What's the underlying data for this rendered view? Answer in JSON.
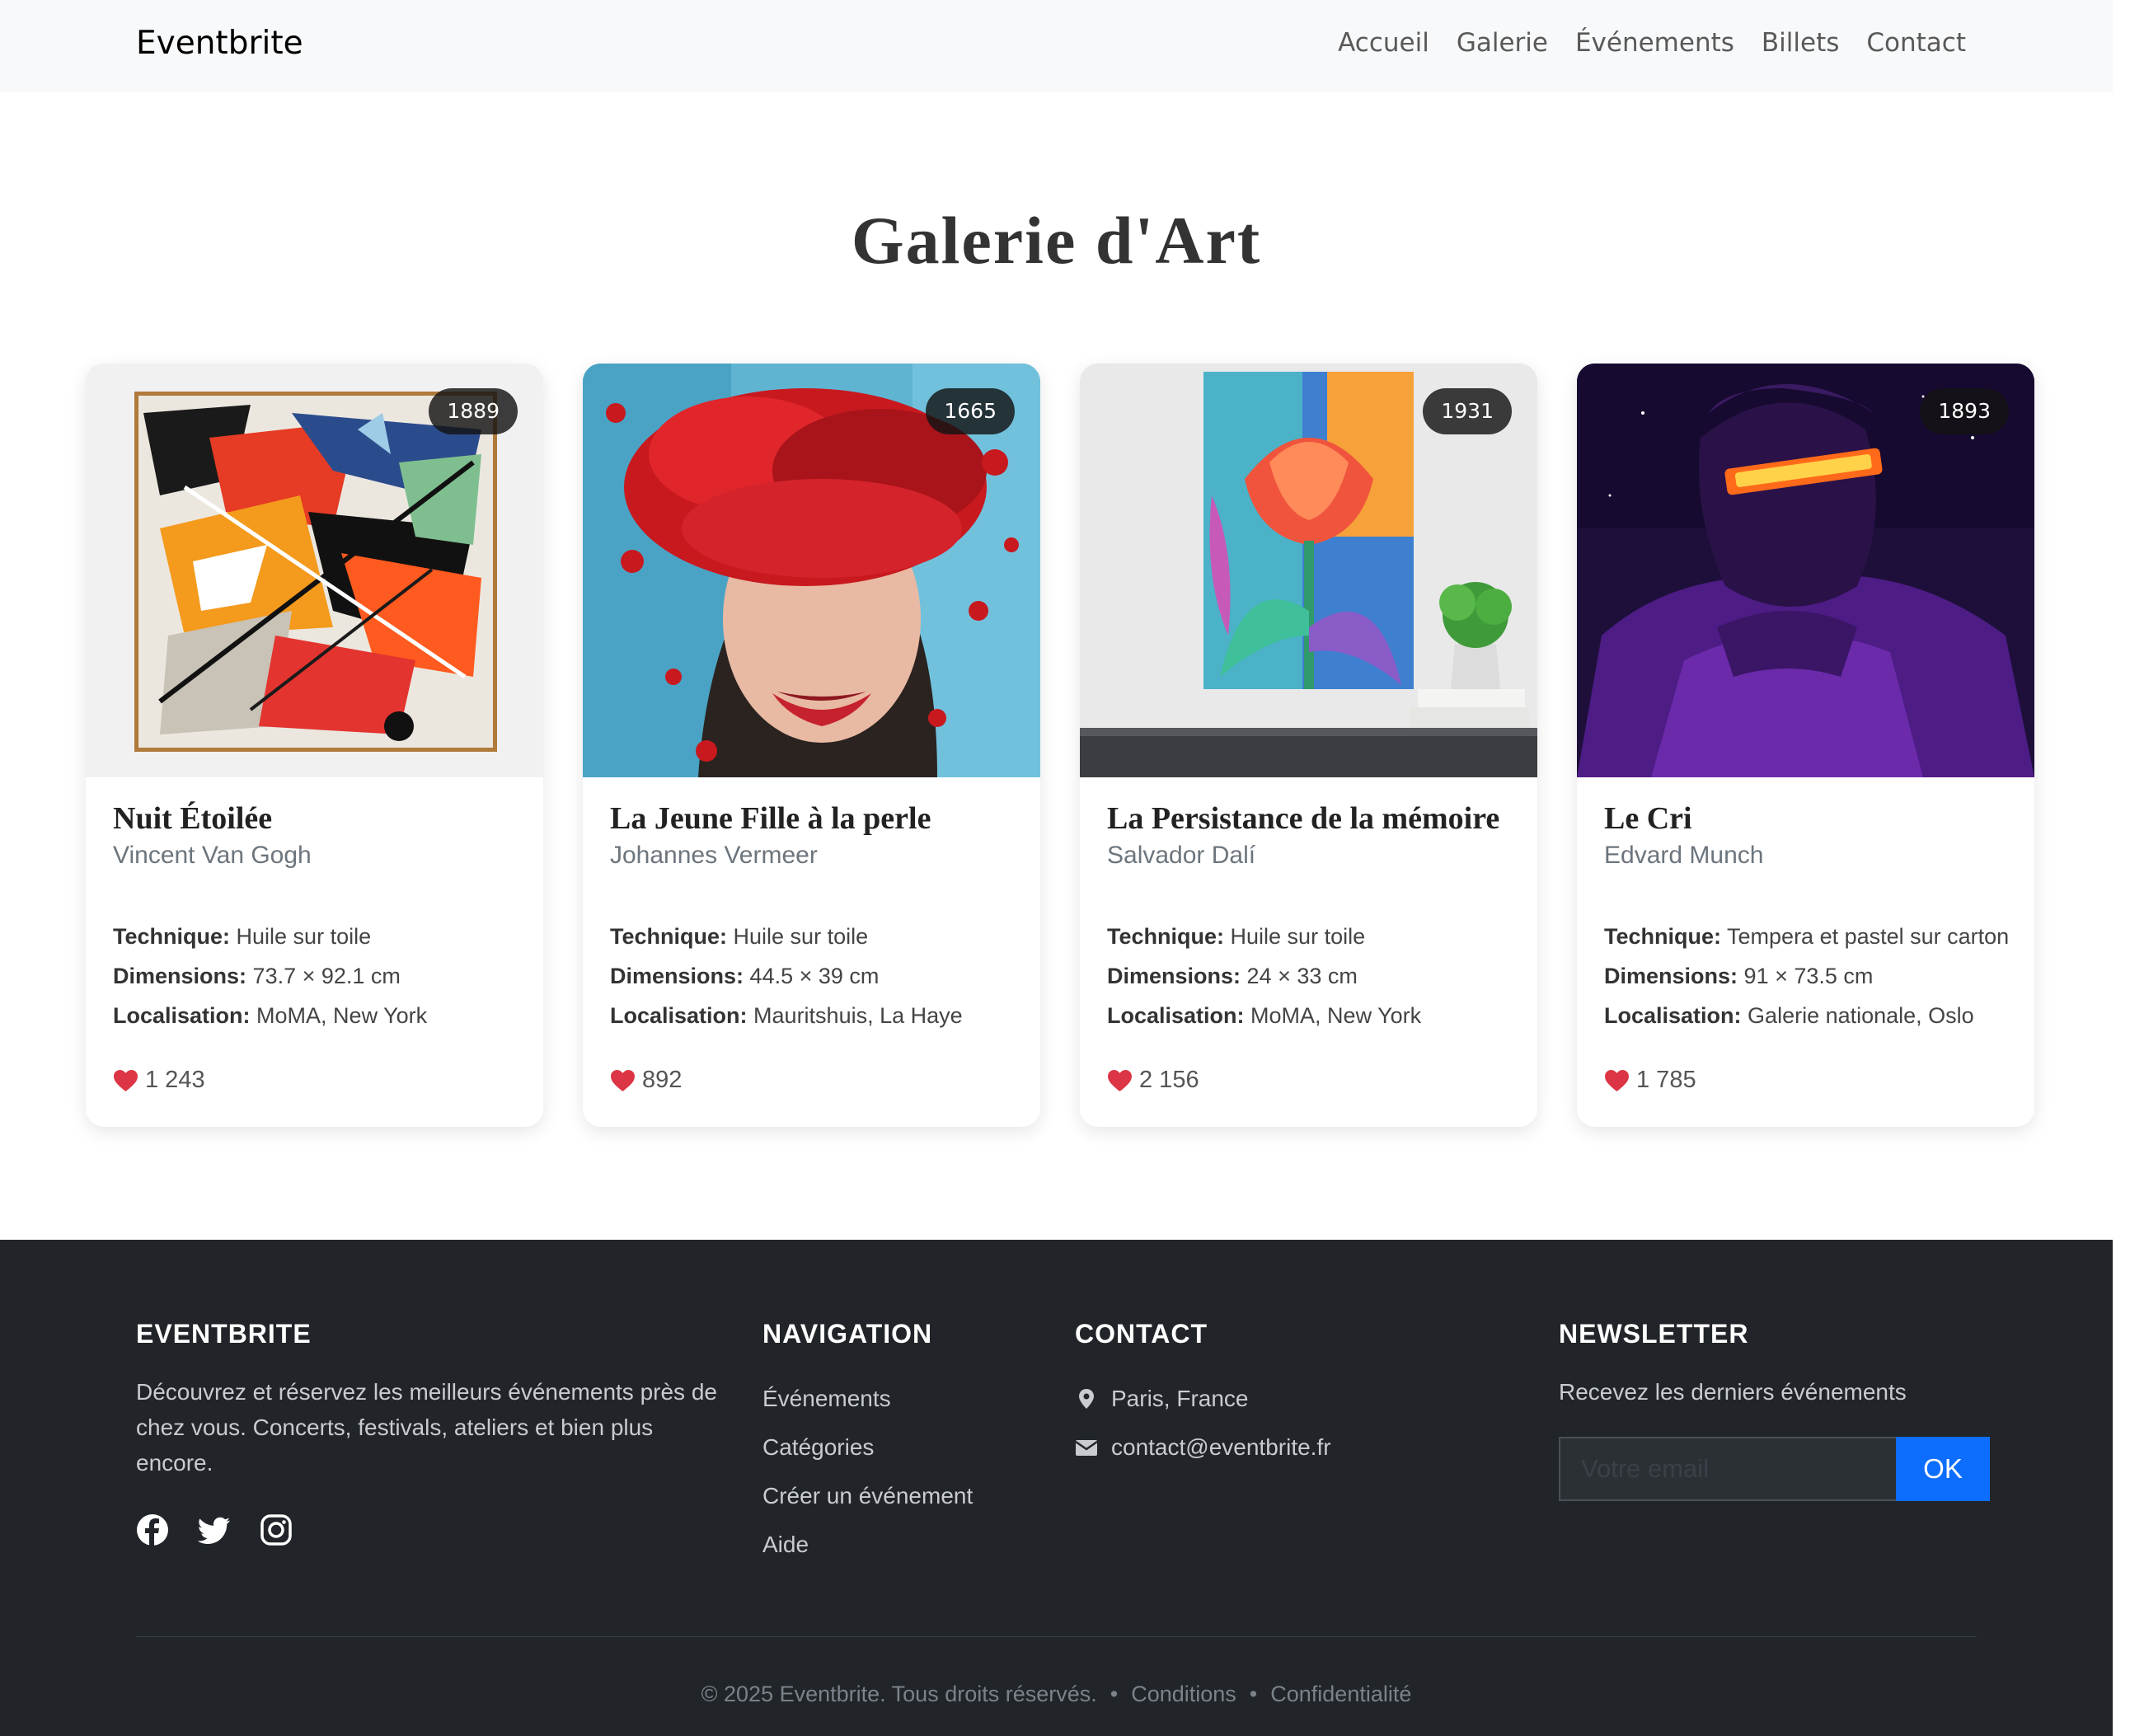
{
  "nav": {
    "brand": "Eventbrite",
    "links": [
      "Accueil",
      "Galerie",
      "Événements",
      "Billets",
      "Contact"
    ]
  },
  "page": {
    "title": "Galerie d'Art"
  },
  "labels": {
    "technique": "Technique:",
    "dimensions": "Dimensions:",
    "location": "Localisation:"
  },
  "artworks": [
    {
      "year": "1889",
      "title": "Nuit Étoilée",
      "artist": "Vincent Van Gogh",
      "technique": "Huile sur toile",
      "dimensions": "73.7 × 92.1 cm",
      "location": "MoMA, New York",
      "likes": "1 243"
    },
    {
      "year": "1665",
      "title": "La Jeune Fille à la perle",
      "artist": "Johannes Vermeer",
      "technique": "Huile sur toile",
      "dimensions": "44.5 × 39 cm",
      "location": "Mauritshuis, La Haye",
      "likes": "892"
    },
    {
      "year": "1931",
      "title": "La Persistance de la mémoire",
      "artist": "Salvador Dalí",
      "technique": "Huile sur toile",
      "dimensions": "24 × 33 cm",
      "location": "MoMA, New York",
      "likes": "2 156"
    },
    {
      "year": "1893",
      "title": "Le Cri",
      "artist": "Edvard Munch",
      "technique": "Tempera et pastel sur carton",
      "dimensions": "91 × 73.5 cm",
      "location": "Galerie nationale, Oslo",
      "likes": "1 785"
    }
  ],
  "footer": {
    "about": {
      "heading": "EVENTBRITE",
      "text": "Découvrez et réservez les meilleurs événements près de chez vous. Concerts, festivals, ateliers et bien plus encore.",
      "social_icons": [
        "facebook-icon",
        "twitter-icon",
        "instagram-icon"
      ]
    },
    "navigation": {
      "heading": "NAVIGATION",
      "links": [
        "Événements",
        "Catégories",
        "Créer un événement",
        "Aide"
      ]
    },
    "contact": {
      "heading": "CONTACT",
      "location": "Paris, France",
      "email": "contact@eventbrite.fr"
    },
    "newsletter": {
      "heading": "NEWSLETTER",
      "text": "Recevez les derniers événements",
      "placeholder": "Votre email",
      "button": "OK"
    },
    "copyright": "© 2025 Eventbrite. Tous droits réservés.",
    "separator": "•",
    "legal_links": [
      "Conditions",
      "Confidentialité"
    ]
  },
  "colors": {
    "navbar_bg": "#f8f9fa",
    "footer_bg": "#212529",
    "heart": "#dc3545",
    "primary": "#0d6efd"
  }
}
